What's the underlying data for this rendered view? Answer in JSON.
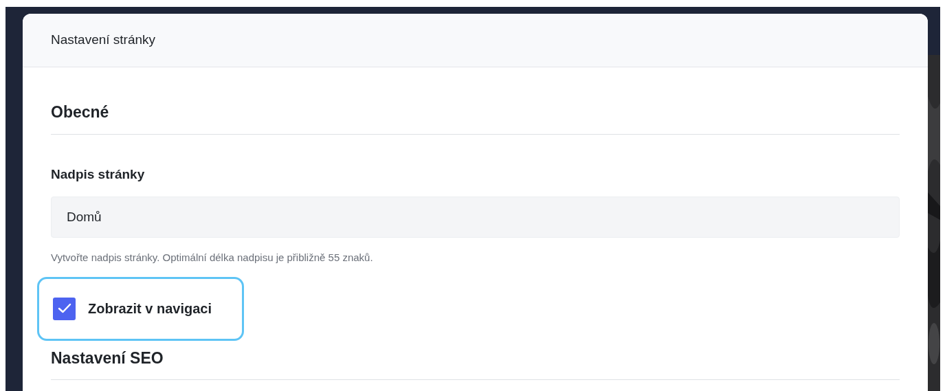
{
  "dialog": {
    "title": "Nastavení stránky"
  },
  "general": {
    "heading": "Obecné",
    "title_field": {
      "label": "Nadpis stránky",
      "value": "Domů",
      "hint": "Vytvořte nadpis stránky. Optimální délka nadpisu je přibližně 55 znaků."
    },
    "nav_checkbox": {
      "label": "Zobrazit v navigaci",
      "checked": true,
      "focused": true
    }
  },
  "seo": {
    "heading": "Nastavení SEO"
  }
}
